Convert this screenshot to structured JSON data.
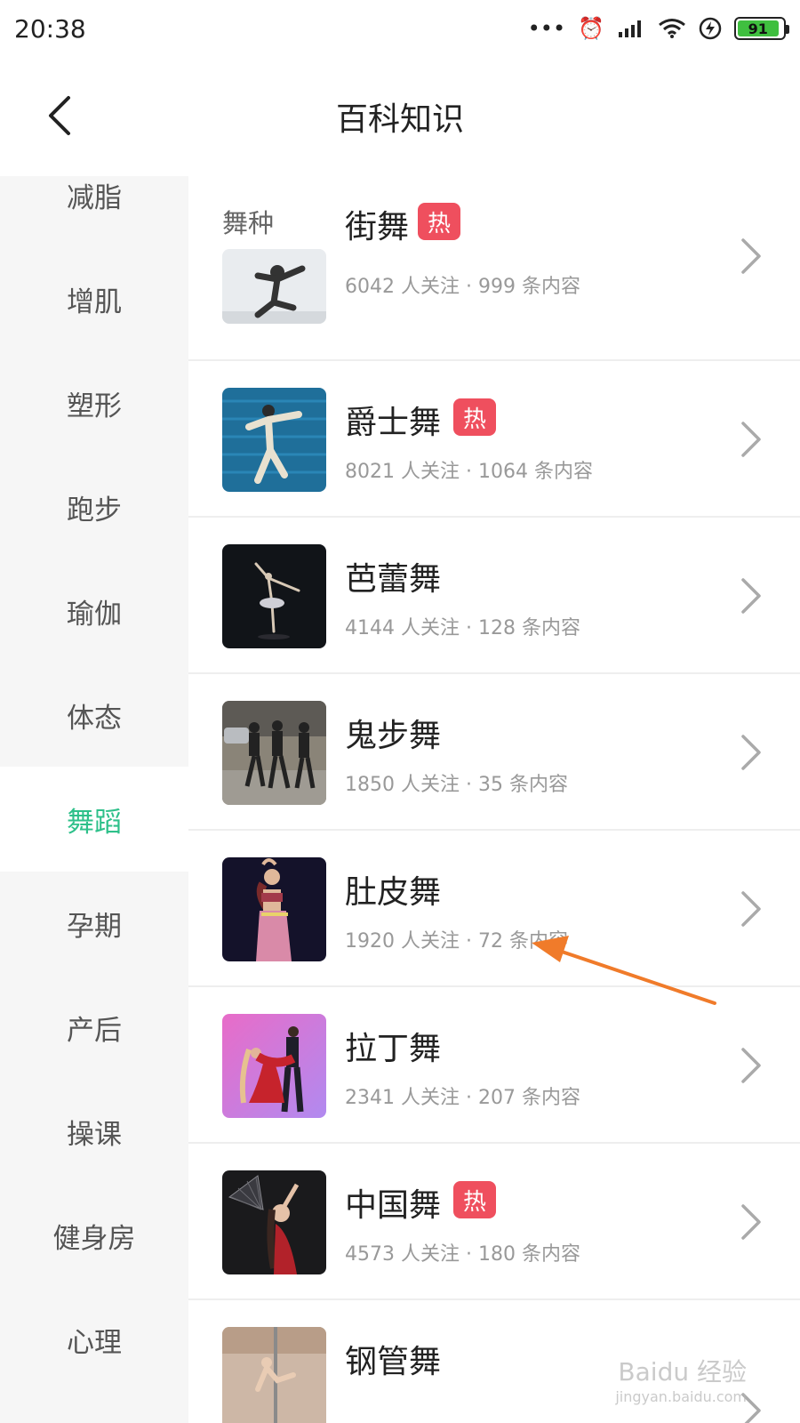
{
  "status_bar": {
    "time": "20:38",
    "battery": "91"
  },
  "header": {
    "title": "百科知识"
  },
  "sidebar": {
    "items": [
      {
        "label": "减脂",
        "active": false
      },
      {
        "label": "增肌",
        "active": false
      },
      {
        "label": "塑形",
        "active": false
      },
      {
        "label": "跑步",
        "active": false
      },
      {
        "label": "瑜伽",
        "active": false
      },
      {
        "label": "体态",
        "active": false
      },
      {
        "label": "舞蹈",
        "active": true
      },
      {
        "label": "孕期",
        "active": false
      },
      {
        "label": "产后",
        "active": false
      },
      {
        "label": "操课",
        "active": false
      },
      {
        "label": "健身房",
        "active": false
      },
      {
        "label": "心理",
        "active": false
      }
    ]
  },
  "main": {
    "section_title": "舞种",
    "rows": [
      {
        "name": "街舞",
        "hot": true,
        "hot_label": "热",
        "meta": "6042 人关注 · 999 条内容"
      },
      {
        "name": "爵士舞",
        "hot": true,
        "hot_label": "热",
        "meta": "8021 人关注 · 1064 条内容"
      },
      {
        "name": "芭蕾舞",
        "hot": false,
        "hot_label": "",
        "meta": "4144 人关注 · 128 条内容"
      },
      {
        "name": "鬼步舞",
        "hot": false,
        "hot_label": "",
        "meta": "1850 人关注 · 35 条内容"
      },
      {
        "name": "肚皮舞",
        "hot": false,
        "hot_label": "",
        "meta": "1920 人关注 · 72 条内容"
      },
      {
        "name": "拉丁舞",
        "hot": false,
        "hot_label": "",
        "meta": "2341 人关注 · 207 条内容"
      },
      {
        "name": "中国舞",
        "hot": true,
        "hot_label": "热",
        "meta": "4573 人关注 · 180 条内容"
      },
      {
        "name": "钢管舞",
        "hot": false,
        "hot_label": "",
        "meta": ""
      }
    ]
  },
  "watermark": {
    "brand": "Baidu 经验",
    "url": "jingyan.baidu.com"
  },
  "colors": {
    "accent": "#2ec08a",
    "hot_badge": "#ef4f5e",
    "annotation_arrow": "#f07b2a"
  },
  "icons": {
    "back": "chevron-left-icon",
    "row_arrow": "chevron-right-icon"
  }
}
